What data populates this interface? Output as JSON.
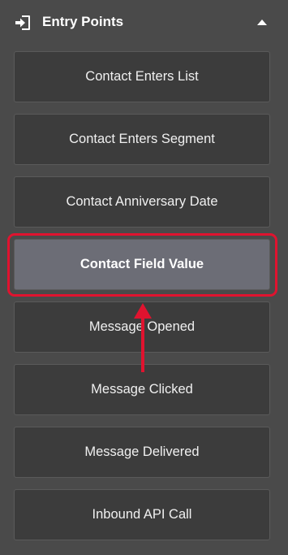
{
  "header": {
    "title": "Entry Points",
    "icon": "sign-in-icon",
    "collapse_icon": "caret-up-icon"
  },
  "items": [
    {
      "label": "Contact Enters List"
    },
    {
      "label": "Contact Enters Segment"
    },
    {
      "label": "Contact Anniversary Date"
    },
    {
      "label": "Contact Field Value",
      "selected": true
    },
    {
      "label": "Message Opened"
    },
    {
      "label": "Message Clicked"
    },
    {
      "label": "Message Delivered"
    },
    {
      "label": "Inbound API Call"
    }
  ],
  "colors": {
    "panel_bg": "#4a4a4a",
    "item_bg": "#3c3c3c",
    "item_active_bg": "#6c6d76",
    "highlight": "#e0132f"
  }
}
